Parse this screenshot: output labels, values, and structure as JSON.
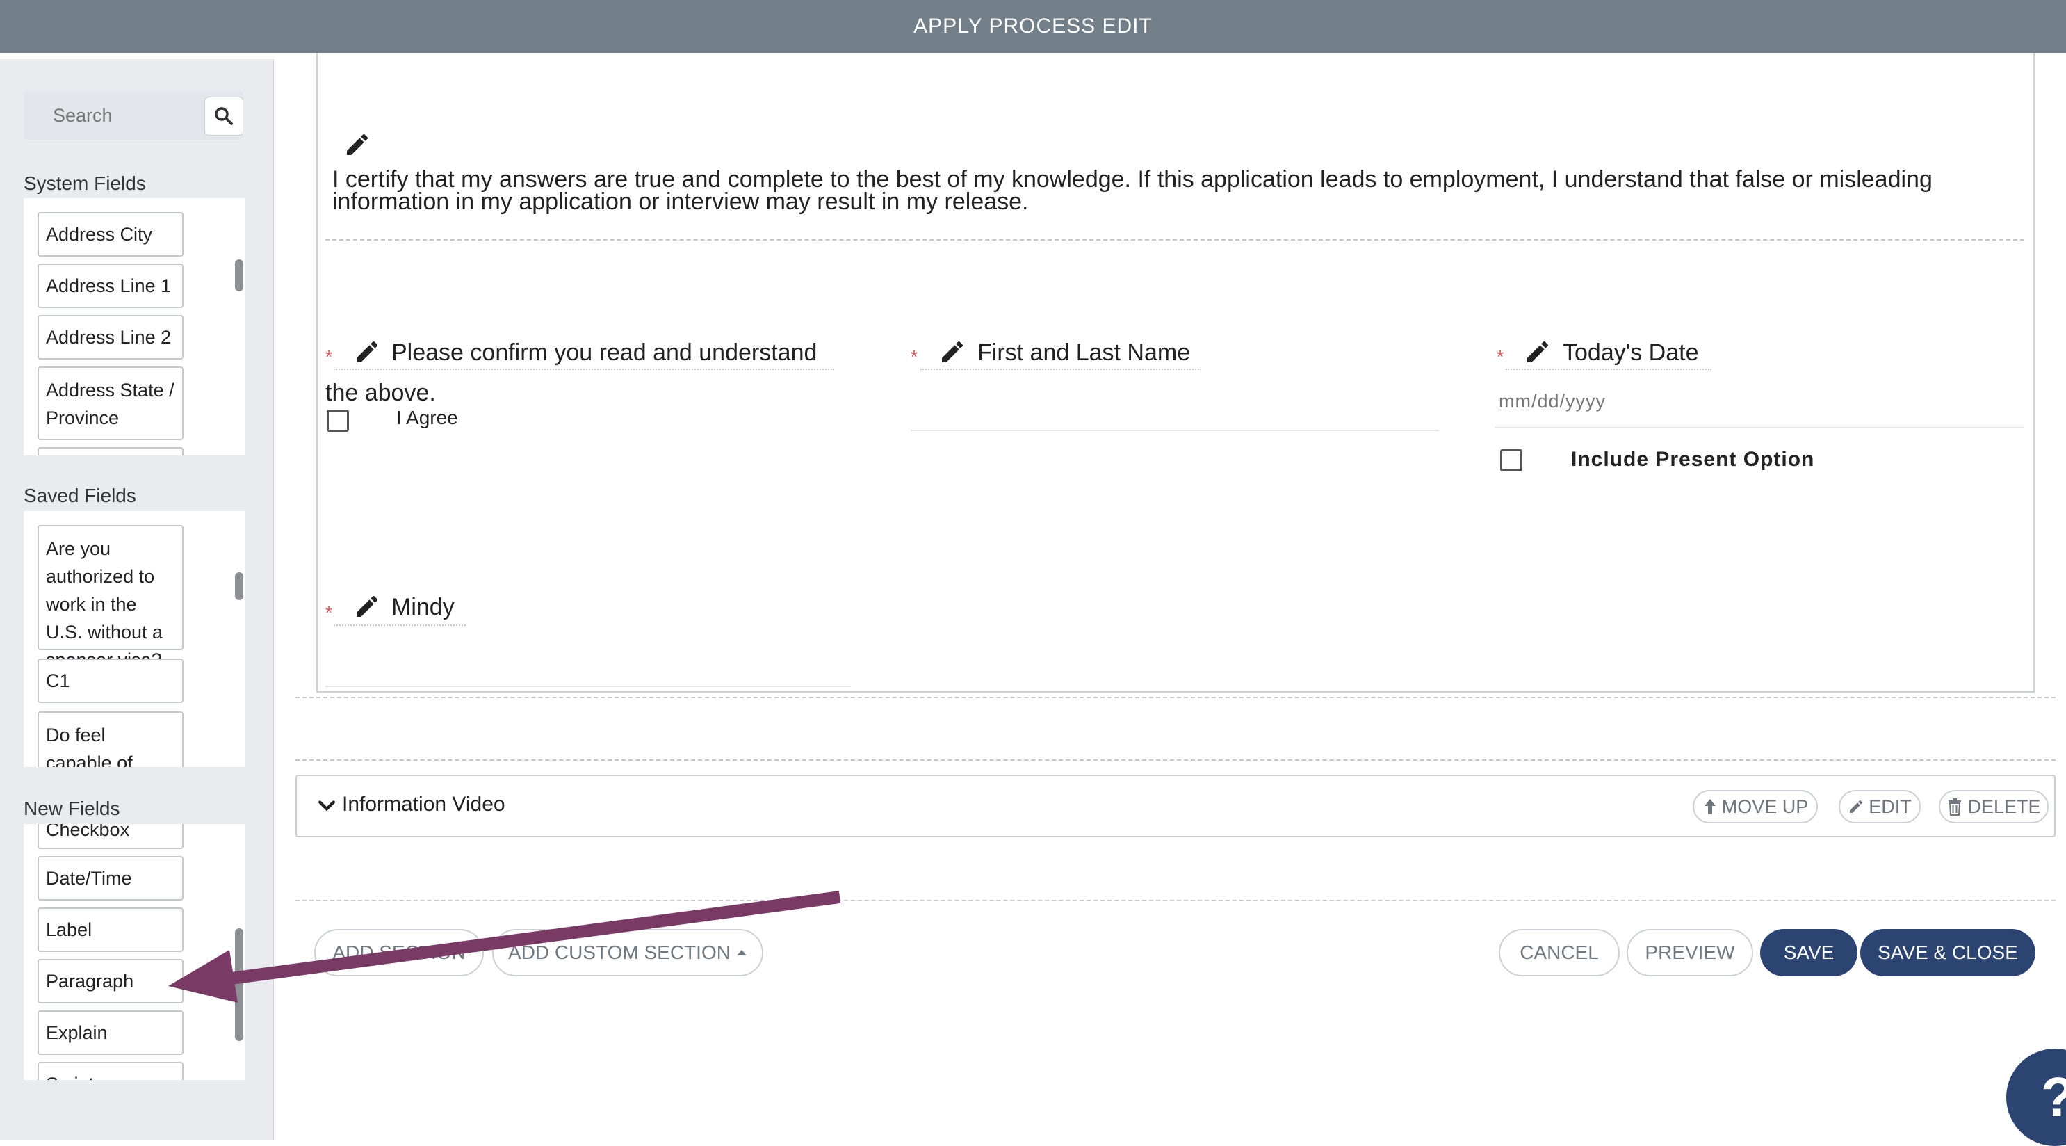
{
  "header": {
    "title": "APPLY PROCESS EDIT"
  },
  "sidebar": {
    "search_placeholder": "Search",
    "system_fields": {
      "title": "System Fields",
      "items": [
        "Address City",
        "Address Line 1",
        "Address Line 2",
        "Address State / Province"
      ]
    },
    "saved_fields": {
      "title": "Saved Fields",
      "items": [
        "Are you authorized to work in the U.S. without a sponsor visa?",
        "C1",
        "Do feel capable of performing the"
      ]
    },
    "new_fields": {
      "title": "New Fields",
      "items": [
        "Checkbox",
        "Date/Time",
        "Label",
        "Paragraph",
        "Explain",
        "Script"
      ]
    }
  },
  "form": {
    "certify_text": "I certify that my answers are true and complete to the best of my knowledge. If this application leads to employment, I understand that false or misleading information in my application or interview may result in my release.",
    "confirm_label_line1": "Please confirm you read and understand",
    "confirm_label_line2": "the above.",
    "agree_label": "I Agree",
    "name_label": "First and Last Name",
    "date_label": "Today's Date",
    "date_placeholder": "mm/dd/yyyy",
    "present_option_label": "Include Present Option",
    "mindy_label": "Mindy",
    "required_mark": "*"
  },
  "section": {
    "title": "Information Video",
    "move_up": "MOVE UP",
    "edit": "EDIT",
    "delete": "DELETE"
  },
  "footer": {
    "add_section": "ADD SECTION",
    "add_custom_section": "ADD CUSTOM SECTION",
    "cancel": "CANCEL",
    "preview": "PREVIEW",
    "save": "SAVE",
    "save_close": "SAVE & CLOSE"
  },
  "help": {
    "label": "?"
  },
  "colors": {
    "header": "#737f88",
    "primary": "#2c4472",
    "arrow": "#7a3a66",
    "required": "#d9534f"
  }
}
